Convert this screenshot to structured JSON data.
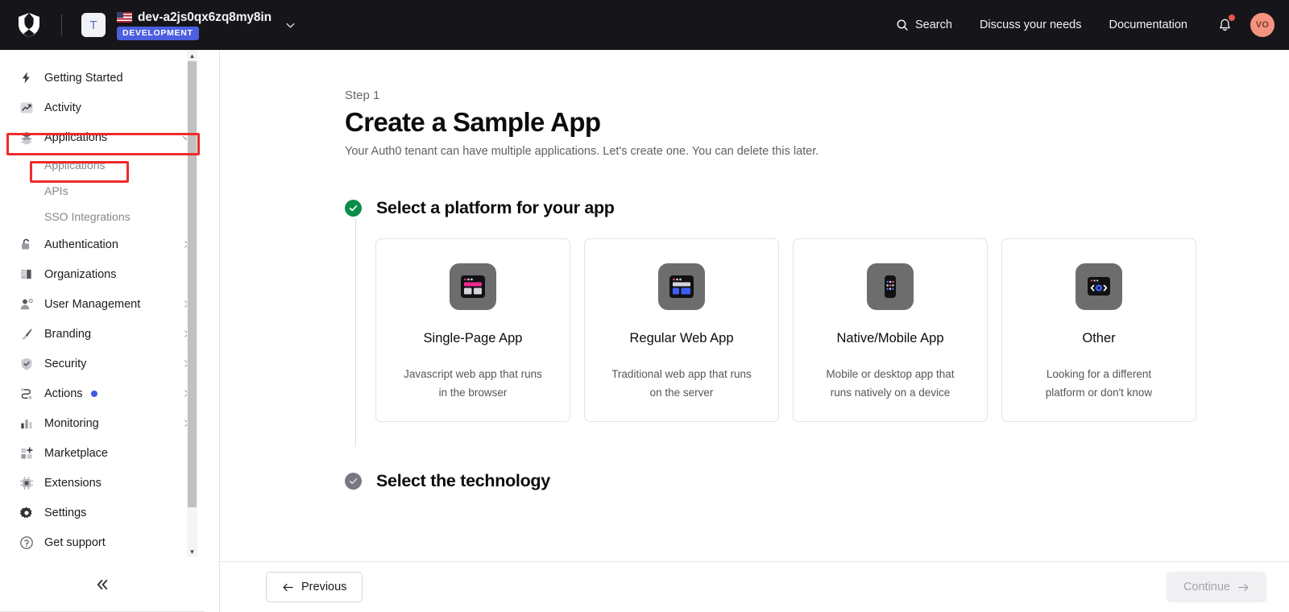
{
  "topbar": {
    "logo_icon": "auth0-shield-logo",
    "tenant_tile_letter": "T",
    "tenant_name": "dev-a2js0qx6zq8my8in",
    "tenant_flag": "us-flag-icon",
    "tenant_badge": "DEVELOPMENT",
    "tenant_caret_icon": "chevron-down-icon",
    "nav": [
      {
        "label": "Search",
        "icon": "search-icon"
      },
      {
        "label": "Discuss your needs",
        "icon": ""
      },
      {
        "label": "Documentation",
        "icon": ""
      }
    ],
    "bell_icon": "notification-bell-icon",
    "bell_has_alert": true,
    "avatar_initials": "VO",
    "avatar_color": "#f4937f",
    "badge_color": "#4b5fe0"
  },
  "sidebar": {
    "items": [
      {
        "label": "Getting Started",
        "icon": "lightning-bolt-icon",
        "expandable": false
      },
      {
        "label": "Activity",
        "icon": "activity-chart-icon",
        "expandable": false
      },
      {
        "label": "Applications",
        "icon": "stack-layers-icon",
        "expandable": true,
        "expanded": true,
        "highlighted": true
      },
      {
        "label": "Authentication",
        "icon": "unlock-padlock-icon",
        "expandable": true
      },
      {
        "label": "Organizations",
        "icon": "building-icon",
        "expandable": false
      },
      {
        "label": "User Management",
        "icon": "user-gear-icon",
        "expandable": true
      },
      {
        "label": "Branding",
        "icon": "paintbrush-icon",
        "expandable": true
      },
      {
        "label": "Security",
        "icon": "shield-check-icon",
        "expandable": true
      },
      {
        "label": "Actions",
        "icon": "actions-flow-icon",
        "expandable": true,
        "dot": true
      },
      {
        "label": "Monitoring",
        "icon": "bar-chart-icon",
        "expandable": true
      },
      {
        "label": "Marketplace",
        "icon": "marketplace-grid-icon",
        "expandable": false
      },
      {
        "label": "Extensions",
        "icon": "extensions-puzzle-icon",
        "expandable": false
      },
      {
        "label": "Settings",
        "icon": "gear-icon",
        "expandable": false
      },
      {
        "label": "Get support",
        "icon": "question-circle-icon",
        "expandable": false
      }
    ],
    "subitems": [
      {
        "label": "Applications",
        "active": true,
        "highlighted": true
      },
      {
        "label": "APIs",
        "active": false
      },
      {
        "label": "SSO Integrations",
        "active": false
      }
    ],
    "collapse_icon": "chevron-double-left-icon",
    "annotation_color": "#ef2b2b"
  },
  "main": {
    "step_eyebrow": "Step 1",
    "title": "Create a Sample App",
    "subtitle": "Your Auth0 tenant can have multiple applications. Let's create one. You can delete this later.",
    "steps": [
      {
        "title": "Select a platform for your app",
        "state": "done",
        "check_icon": "check-circle-icon"
      },
      {
        "title": "Select the technology",
        "state": "pending",
        "check_icon": "check-circle-icon"
      }
    ],
    "platform_cards": [
      {
        "title": "Single-Page App",
        "description": "Javascript web app that runs in the browser",
        "icon": "single-page-app-icon",
        "accent": "#f0298f"
      },
      {
        "title": "Regular Web App",
        "description": "Traditional web app that runs on the server",
        "icon": "regular-web-app-icon",
        "accent": "#3c5ef5"
      },
      {
        "title": "Native/Mobile App",
        "description": "Mobile or desktop app that runs natively on a device",
        "icon": "native-mobile-app-icon",
        "accent": "#3c5ef5"
      },
      {
        "title": "Other",
        "description": "Looking for a different platform or don't know",
        "icon": "other-platform-icon",
        "accent": "#3c5ef5"
      }
    ]
  },
  "footer": {
    "previous_label": "Previous",
    "previous_icon": "arrow-left-icon",
    "continue_label": "Continue",
    "continue_icon": "arrow-right-icon",
    "continue_disabled": true
  }
}
